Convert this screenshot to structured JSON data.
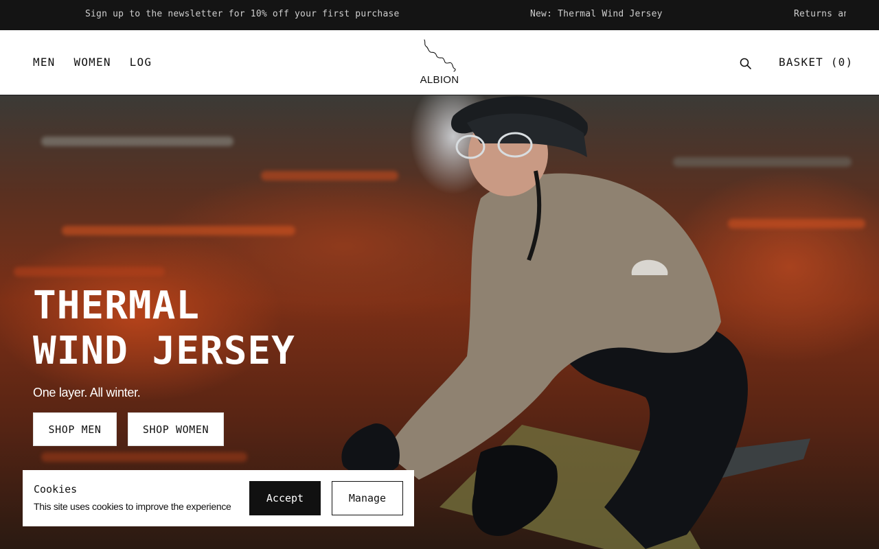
{
  "announcement": {
    "messages": [
      "Sign up to the newsletter for 10% off your first purchase",
      "New: Thermal Wind Jersey",
      "Returns and exchanges"
    ]
  },
  "header": {
    "nav": [
      {
        "label": "MEN"
      },
      {
        "label": "WOMEN"
      },
      {
        "label": "LOG"
      }
    ],
    "logo_text": "ALBION",
    "search_icon": "search-icon",
    "basket_label": "BASKET (0)"
  },
  "hero": {
    "title_line1": "THERMAL",
    "title_line2": "WIND JERSEY",
    "subtitle": "One layer. All winter.",
    "shop_men_label": "SHOP MEN",
    "shop_women_label": "SHOP WOMEN"
  },
  "cookie": {
    "title": "Cookies",
    "text": "This site uses cookies to improve the experience",
    "accept_label": "Accept",
    "manage_label": "Manage"
  },
  "colors": {
    "announcement_bg": "#141414",
    "button_dark": "#111111",
    "accent_hero": "#7c2f16"
  }
}
